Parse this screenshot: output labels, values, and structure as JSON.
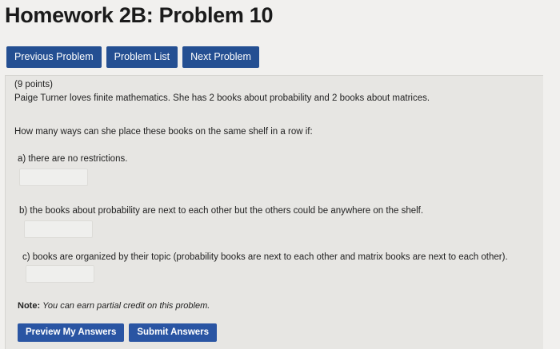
{
  "header": {
    "title": "Homework 2B: Problem 10"
  },
  "nav": {
    "previous_label": "Previous Problem",
    "list_label": "Problem List",
    "next_label": "Next Problem"
  },
  "problem": {
    "points": "(9 points)",
    "statement": "Paige Turner loves finite mathematics. She has 2 books about probability and 2 books about matrices.",
    "question": "How many ways can she place these books on the same shelf in a row if:",
    "part_a": "a) there are no restrictions.",
    "part_b": "b) the books about probability are next to each other but the others could be anywhere on the shelf.",
    "part_c": "c) books are organized by their topic (probability books are next to each other and matrix books are next to each other).",
    "answer_a": "",
    "answer_b": "",
    "answer_c": ""
  },
  "note": {
    "label": "Note:",
    "text": "You can earn partial credit on this problem."
  },
  "actions": {
    "preview_label": "Preview My Answers",
    "submit_label": "Submit Answers"
  }
}
